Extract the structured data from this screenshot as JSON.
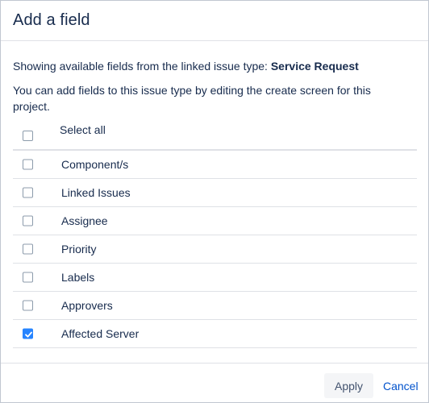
{
  "dialog": {
    "title": "Add a field",
    "info_prefix": "Showing available fields from the linked issue type: ",
    "issue_type": "Service Request",
    "info_2": "You can add fields to this issue type by editing the create screen for this project."
  },
  "select_all": {
    "label": "Select all",
    "checked": false
  },
  "fields": [
    {
      "label": "Component/s",
      "checked": false
    },
    {
      "label": "Linked Issues",
      "checked": false
    },
    {
      "label": "Assignee",
      "checked": false
    },
    {
      "label": "Priority",
      "checked": false
    },
    {
      "label": "Labels",
      "checked": false
    },
    {
      "label": "Approvers",
      "checked": false
    },
    {
      "label": "Affected Server",
      "checked": true
    }
  ],
  "footer": {
    "apply_label": "Apply",
    "cancel_label": "Cancel"
  },
  "colors": {
    "accent": "#2684ff",
    "link": "#0052cc",
    "text": "#172b4d",
    "border": "#dfe1e6"
  }
}
